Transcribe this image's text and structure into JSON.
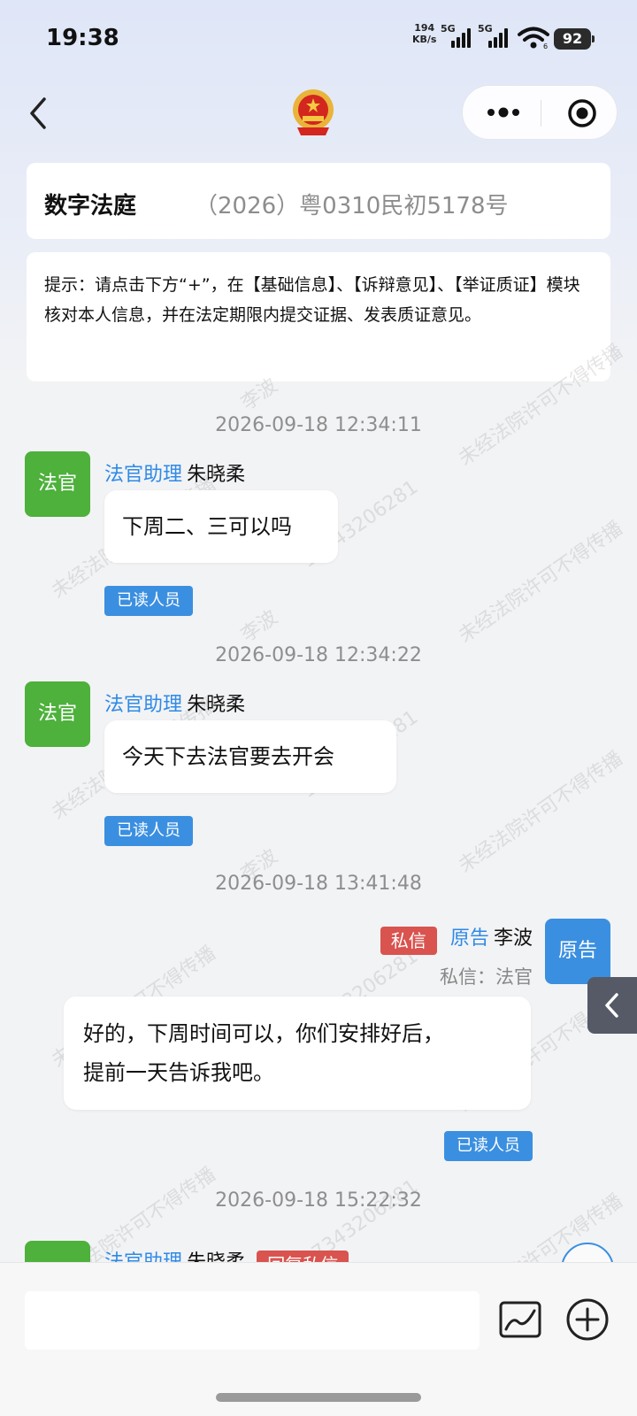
{
  "status_bar": {
    "time": "19:38",
    "net_speed_value": "194",
    "net_speed_unit": "KB/s",
    "sim1": "5G",
    "sim2": "5G",
    "wifi_sub": "6",
    "battery": "92"
  },
  "nav": {
    "back_icon": "chevron-left-icon",
    "emblem_icon": "national-emblem-icon",
    "more_icon": "more-dots-icon",
    "close_icon": "record-circle-icon"
  },
  "court": {
    "title": "数字法庭",
    "case_number": "（2026）粤0310民初5178号"
  },
  "tip": {
    "text": "提示：请点击下方“+”，在【基础信息】、【诉辩意见】、【举证质证】模块核对本人信息，并在法定期限内提交证据、发表质证意见。"
  },
  "watermark": {
    "text1": "未经法院许可不得传播",
    "text2": "李波",
    "text3": "17343206281"
  },
  "messages": [
    {
      "timestamp": "2026-09-18 12:34:11",
      "avatar": "法官",
      "role": "法官助理",
      "name": "朱晓柔",
      "text": "下周二、三可以吗",
      "read_label": "已读人员"
    },
    {
      "timestamp": "2026-09-18 12:34:22",
      "avatar": "法官",
      "role": "法官助理",
      "name": "朱晓柔",
      "text": "今天下去法官要去开会",
      "read_label": "已读人员"
    },
    {
      "timestamp": "2026-09-18 13:41:48",
      "avatar": "原告",
      "tag": "私信",
      "role": "原告",
      "name": "李波",
      "private_to": "私信：法官",
      "line1": "好的，下周时间可以，你们安排好后，",
      "line2": "提前一天告诉我吧。",
      "read_label": "已读人员"
    },
    {
      "timestamp": "2026-09-18 15:22:32",
      "role": "法官助理",
      "name": "朱晓柔",
      "tag": "回复私信"
    }
  ],
  "bottom_bar": {
    "input_placeholder": "",
    "image_icon": "image-chart-icon",
    "plus_icon": "plus-circle-icon"
  },
  "colors": {
    "accent_blue": "#3b8fe0",
    "judge_green": "#4db13b",
    "private_red": "#d9534f"
  }
}
